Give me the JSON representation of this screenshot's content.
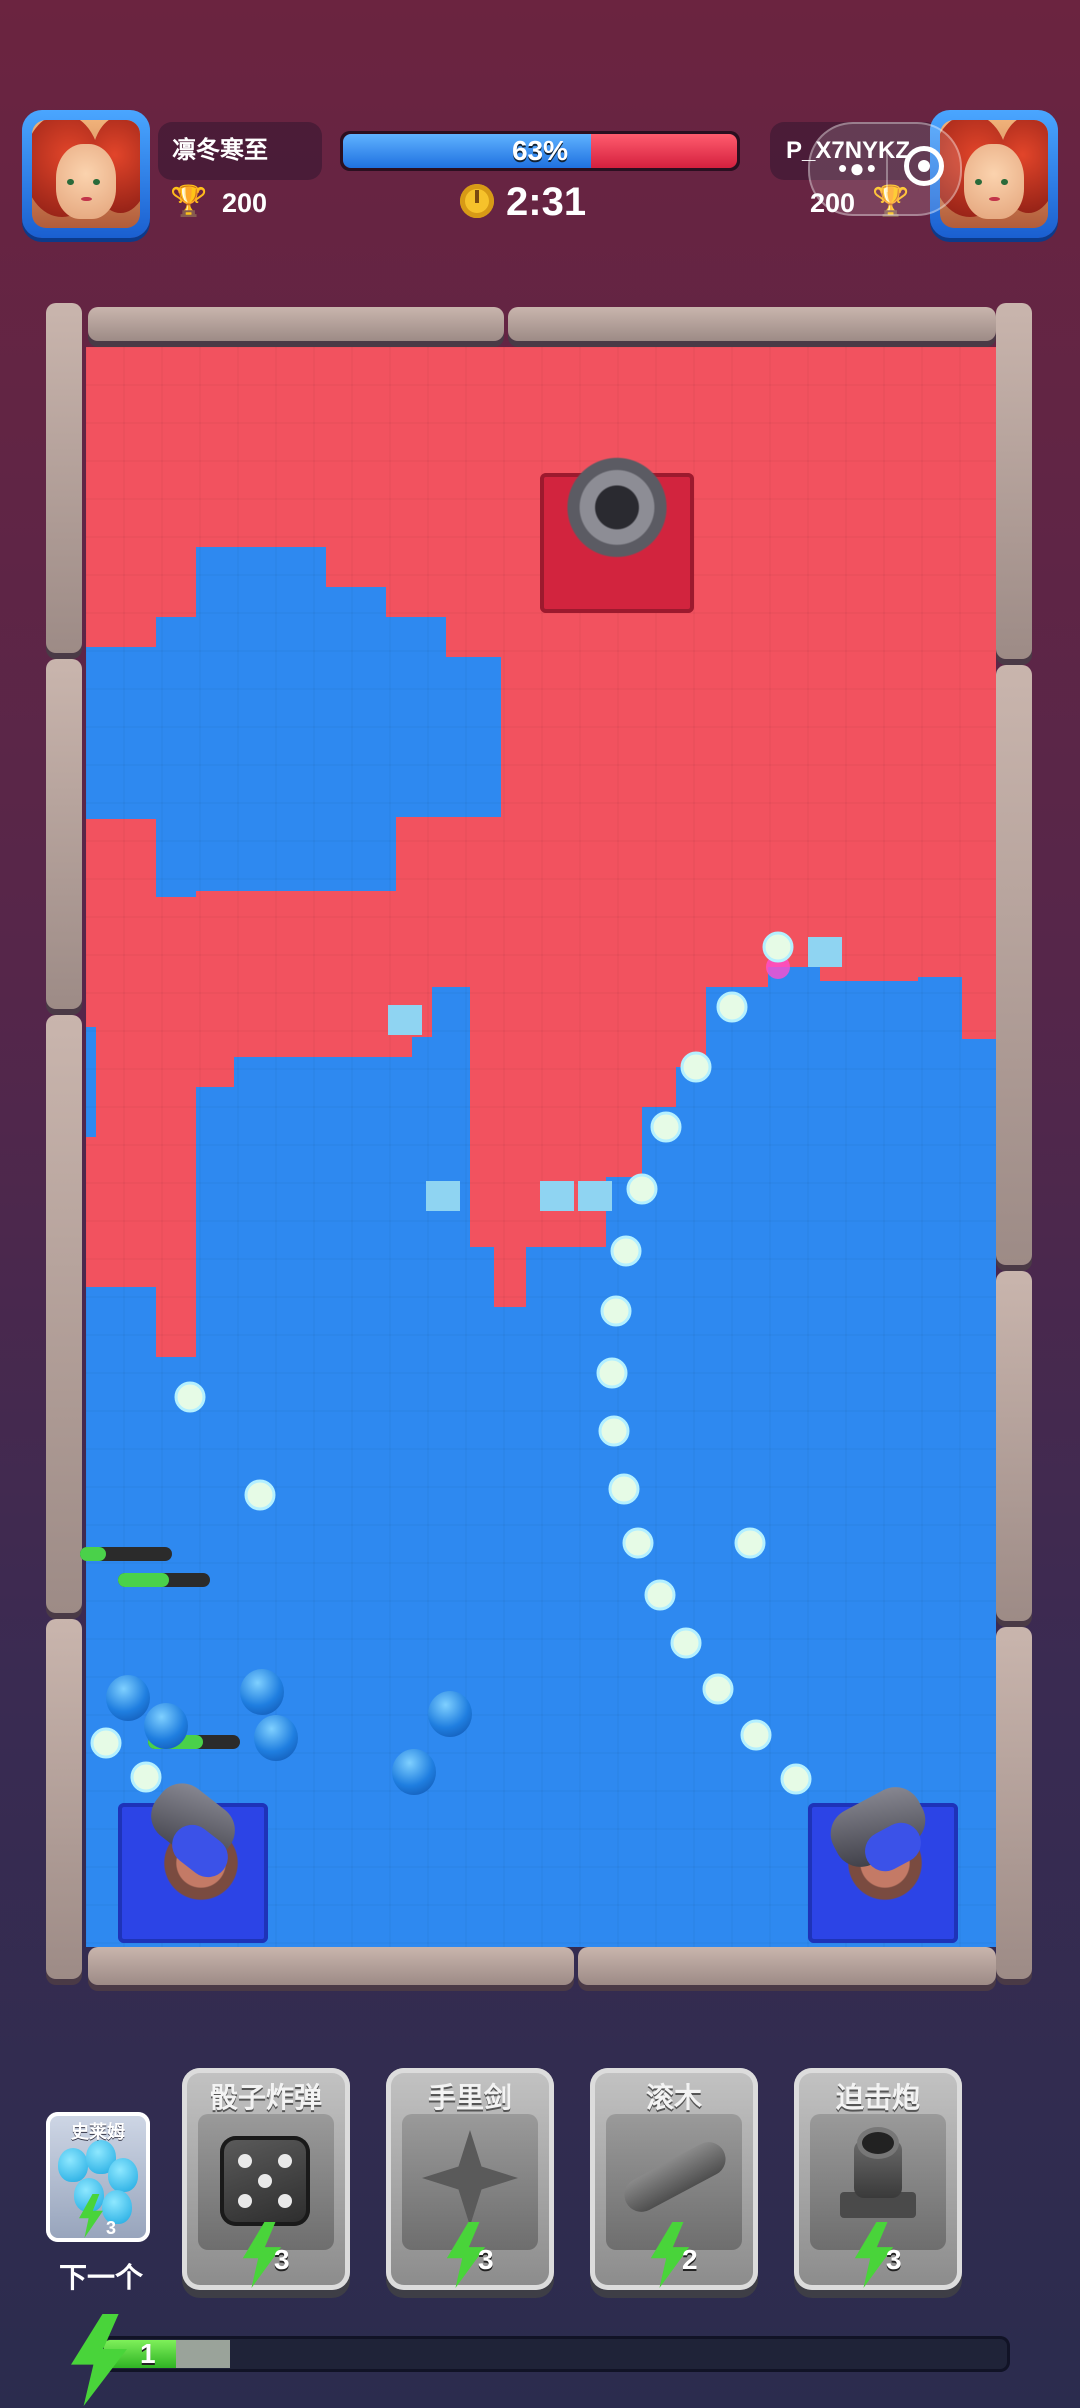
{
  "hud": {
    "player": {
      "name": "凛冬寒至",
      "trophies": "200"
    },
    "opponent": {
      "name": "P_X7NYKZ",
      "trophies": "200"
    },
    "territory_percent": "63%",
    "territory_fraction_blue": 0.63,
    "timer": "2:31"
  },
  "arena": {
    "colors": {
      "blue": "#2e89f0",
      "red": "#f2525f",
      "wall": "#b9a8a2",
      "pad": "#2c44e6"
    }
  },
  "deck": {
    "next_label": "下一个",
    "next_card": {
      "name": "史莱姆",
      "cost": "3"
    },
    "cards": [
      {
        "name": "骰子炸弹",
        "cost": "3",
        "icon": "dice-icon"
      },
      {
        "name": "手里剑",
        "cost": "3",
        "icon": "shuriken-icon"
      },
      {
        "name": "滚木",
        "cost": "2",
        "icon": "log-icon"
      },
      {
        "name": "迫击炮",
        "cost": "3",
        "icon": "mortar-icon"
      }
    ],
    "elixir": {
      "count": "1",
      "fill_fraction": 0.08,
      "pending_fraction": 0.06
    }
  }
}
